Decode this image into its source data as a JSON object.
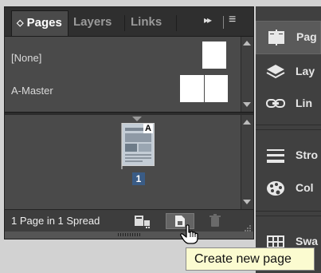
{
  "tabs": [
    {
      "label": "Pages",
      "active": true,
      "chevron": "◇"
    },
    {
      "label": "Layers",
      "active": false
    },
    {
      "label": "Links",
      "active": false
    }
  ],
  "panel_menu": {
    "overflow_glyph": "▸▸",
    "menu_glyph": "≡"
  },
  "masters": [
    {
      "label": "[None]",
      "pages": 1
    },
    {
      "label": "A-Master",
      "pages": 2
    }
  ],
  "page_thumbnail": {
    "master_letter": "A",
    "page_number": "1"
  },
  "footer": {
    "status": "1 Page in 1 Spread"
  },
  "tooltip": {
    "text": "Create new page"
  },
  "right_panel": {
    "items": [
      {
        "label": "Pag",
        "icon": "pages-icon"
      },
      {
        "label": "Lay",
        "icon": "layers-icon"
      },
      {
        "label": "Lin",
        "icon": "links-icon"
      },
      {
        "label": "Stro",
        "icon": "stroke-icon"
      },
      {
        "label": "Col",
        "icon": "color-icon"
      },
      {
        "label": "Swa",
        "icon": "swatches-icon"
      }
    ]
  },
  "colors": {
    "panel_bg": "#4a4a4a",
    "tab_bar": "#2f2f2f",
    "selected_page_number": "#3a5c86",
    "tooltip_bg": "#fbfbd0"
  }
}
